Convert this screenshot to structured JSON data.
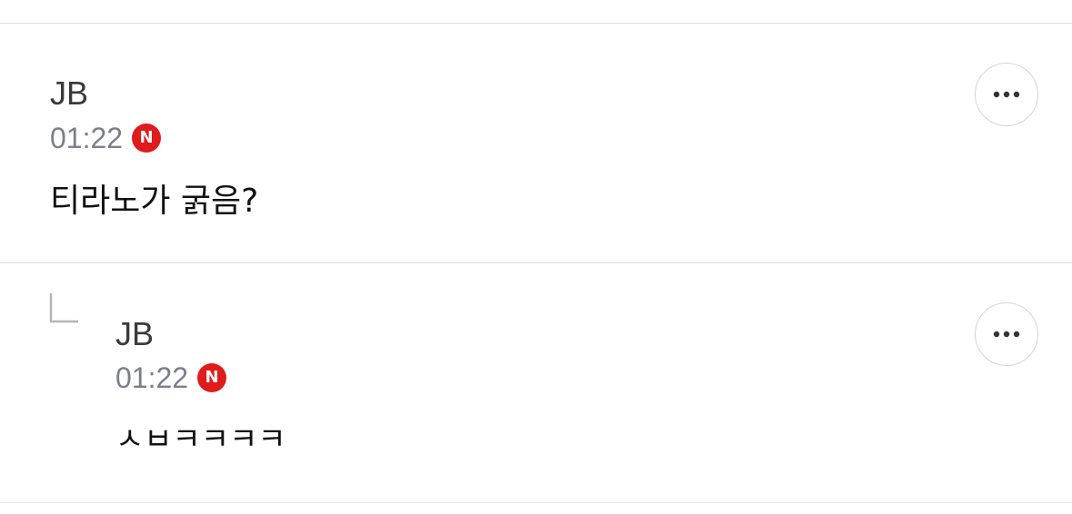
{
  "comments": [
    {
      "author": "JB",
      "time": "01:22",
      "new_badge": "N",
      "text": "티라노가 굵음?",
      "more_icon": "ellipsis-icon"
    }
  ],
  "replies": [
    {
      "author": "JB",
      "time": "01:22",
      "new_badge": "N",
      "text": "ㅅㅂㅋㅋㅋㅋ",
      "more_icon": "ellipsis-icon",
      "reply_icon": "reply-arrow-icon"
    }
  ],
  "colors": {
    "badge": "#e01b1b",
    "time": "#7a7f8c",
    "divider": "#e2e2e2"
  }
}
